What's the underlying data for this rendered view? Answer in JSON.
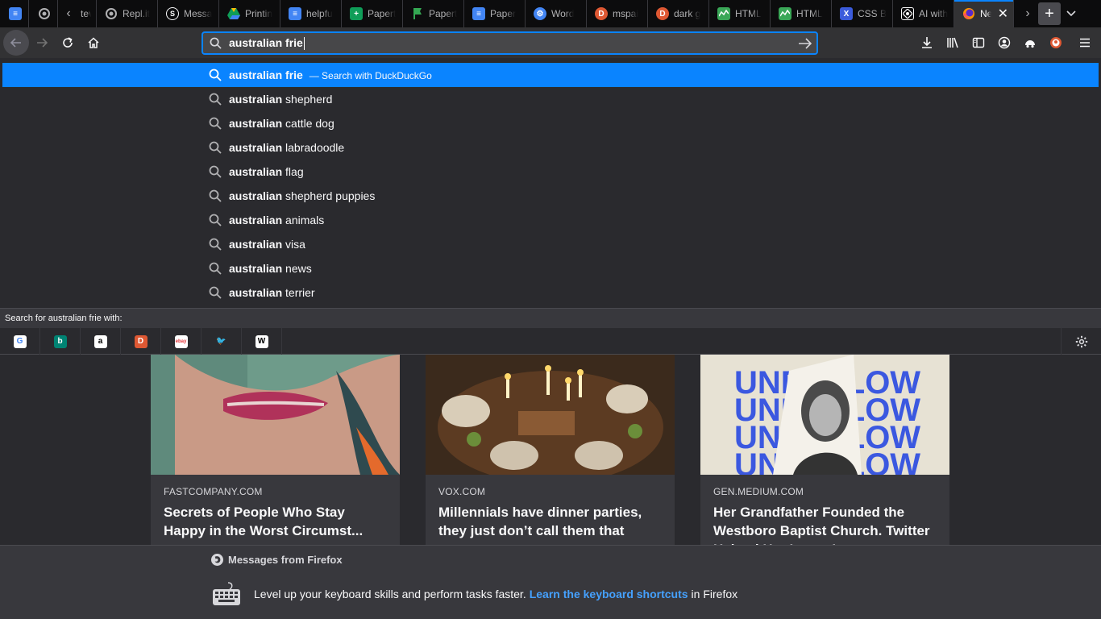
{
  "tabs": [
    {
      "label": "",
      "icon": "google-docs-icon",
      "color": "#4285f4"
    },
    {
      "label": "",
      "icon": "replit-icon",
      "color": "#b1b1b3"
    },
    {
      "label": "tev",
      "icon": "",
      "color": ""
    },
    {
      "label": "Repl.it",
      "icon": "replit-icon",
      "color": "#b1b1b3"
    },
    {
      "label": "Messa",
      "icon": "s-icon",
      "color": "#f9f9fa"
    },
    {
      "label": "Printin",
      "icon": "google-drive-icon",
      "color": "#fbbc04"
    },
    {
      "label": "helpfu",
      "icon": "google-docs-icon",
      "color": "#4285f4"
    },
    {
      "label": "Papert",
      "icon": "google-sheets-icon",
      "color": "#0f9d58"
    },
    {
      "label": "Papert",
      "icon": "flag-icon",
      "color": "#34a853"
    },
    {
      "label": "Paper",
      "icon": "google-docs-icon",
      "color": "#4285f4"
    },
    {
      "label": "Word",
      "icon": "gear-icon",
      "color": "#4285f4"
    },
    {
      "label": "mspai",
      "icon": "duckduckgo-icon",
      "color": "#de5833"
    },
    {
      "label": "dark g",
      "icon": "duckduckgo-icon",
      "color": "#de5833"
    },
    {
      "label": "HTML",
      "icon": "trend-icon",
      "color": "#3aa757"
    },
    {
      "label": "HTML",
      "icon": "trend-icon",
      "color": "#3aa757"
    },
    {
      "label": "CSS B",
      "icon": "x-icon",
      "color": "#3b5bdb"
    },
    {
      "label": "AI with",
      "icon": "ai-icon",
      "color": "#f9f9fa"
    },
    {
      "label": "Ne",
      "icon": "firefox-icon",
      "color": "#ff9500",
      "active": true
    }
  ],
  "urlbar": {
    "value": "australian frie"
  },
  "suggestions": [
    {
      "bold": "australian frie",
      "rest": "",
      "action": "— Search with DuckDuckGo",
      "selected": true
    },
    {
      "bold": "australian",
      "rest": " shepherd"
    },
    {
      "bold": "australian",
      "rest": " cattle dog"
    },
    {
      "bold": "australian",
      "rest": " labradoodle"
    },
    {
      "bold": "australian",
      "rest": " flag"
    },
    {
      "bold": "australian",
      "rest": " shepherd puppies"
    },
    {
      "bold": "australian",
      "rest": " animals"
    },
    {
      "bold": "australian",
      "rest": " visa"
    },
    {
      "bold": "australian",
      "rest": " news"
    },
    {
      "bold": "australian",
      "rest": " terrier"
    }
  ],
  "oneoff": {
    "header": "Search for australian frie with:",
    "engines": [
      {
        "name": "google-engine-icon",
        "glyph": "G",
        "color": "#4285f4",
        "bg": "#ffffff"
      },
      {
        "name": "bing-engine-icon",
        "glyph": "b",
        "color": "#ffffff",
        "bg": "#008373"
      },
      {
        "name": "amazon-engine-icon",
        "glyph": "a",
        "color": "#000000",
        "bg": "#ffffff"
      },
      {
        "name": "duckduckgo-engine-icon",
        "glyph": "D",
        "color": "#ffffff",
        "bg": "#de5833"
      },
      {
        "name": "ebay-engine-icon",
        "glyph": "ebay",
        "color": "#e53238",
        "bg": "#ffffff"
      },
      {
        "name": "twitter-engine-icon",
        "glyph": "🐦",
        "color": "#1da1f2",
        "bg": "transparent"
      },
      {
        "name": "wikipedia-engine-icon",
        "glyph": "W",
        "color": "#000000",
        "bg": "#ffffff"
      }
    ]
  },
  "cards": [
    {
      "source": "FASTCOMPANY.COM",
      "title": "Secrets of People Who Stay Happy in the Worst Circumst..."
    },
    {
      "source": "VOX.COM",
      "title": "Millennials have dinner parties, they just don’t call them that"
    },
    {
      "source": "GEN.MEDIUM.COM",
      "title": "Her Grandfather Founded the Westboro Baptist Church. Twitter Helped Her Leave It"
    }
  ],
  "card_image_text": "UNFOLLOW",
  "messages": {
    "header": "Messages from Firefox",
    "body_before": "Level up your keyboard skills and perform tasks faster.",
    "link": "Learn the keyboard shortcuts",
    "body_after": "in Firefox"
  }
}
